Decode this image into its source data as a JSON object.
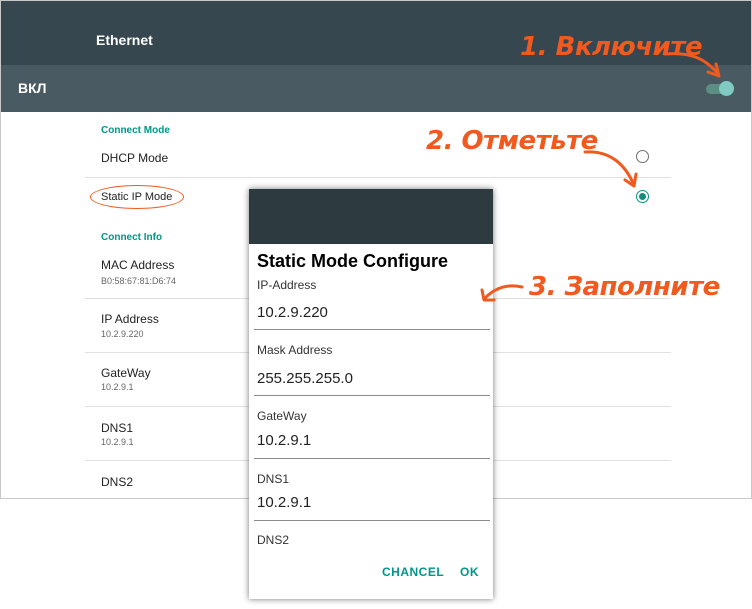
{
  "topbar": {
    "title": "Ethernet"
  },
  "switchbar": {
    "label": "ВКЛ",
    "enabled": true
  },
  "settings": {
    "connect_mode_header": "Connect Mode",
    "dhcp_label": "DHCP Mode",
    "static_label": "Static IP Mode",
    "selected_mode": "Static IP Mode",
    "connect_info_header": "Connect Info",
    "info": [
      {
        "title": "MAC Address",
        "value": "B0:58:67:81:D6:74"
      },
      {
        "title": "IP Address",
        "value": "10.2.9.220"
      },
      {
        "title": "GateWay",
        "value": "10.2.9.1"
      },
      {
        "title": "DNS1",
        "value": "10.2.9.1"
      },
      {
        "title": "DNS2",
        "value": ""
      }
    ]
  },
  "dialog": {
    "title": "Static Mode Configure",
    "fields": [
      {
        "label": "IP-Address",
        "value": "10.2.9.220"
      },
      {
        "label": "Mask Address",
        "value": "255.255.255.0"
      },
      {
        "label": "GateWay",
        "value": "10.2.9.1"
      },
      {
        "label": "DNS1",
        "value": "10.2.9.1"
      },
      {
        "label": "DNS2",
        "value": ""
      }
    ],
    "cancel_label": "CHANCEL",
    "ok_label": "OK"
  },
  "annotations": {
    "step1": "1. Включите",
    "step2": "2. Отметьте",
    "step3": "3. Заполните"
  },
  "colors": {
    "accent": "#009688",
    "annotation": "#f05a1e",
    "header": "#37474f"
  }
}
